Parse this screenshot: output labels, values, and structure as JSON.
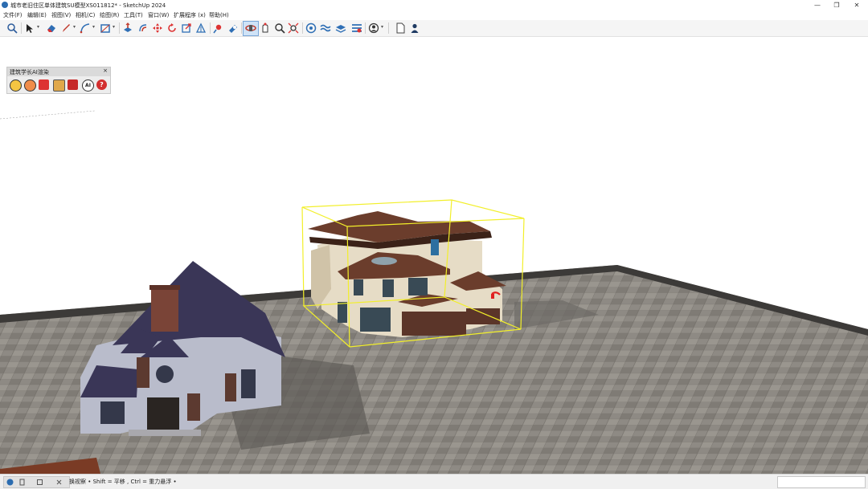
{
  "window": {
    "title": "城市老旧住区单体建筑SU模型XS011812* - SketchUp 2024",
    "minimize_glyph": "—",
    "restore_glyph": "❐",
    "close_glyph": "✕"
  },
  "menu": [
    {
      "label": "文件(F)"
    },
    {
      "label": "编辑(E)"
    },
    {
      "label": "视图(V)"
    },
    {
      "label": "相机(C)"
    },
    {
      "label": "绘图(R)"
    },
    {
      "label": "工具(T)"
    },
    {
      "label": "窗口(W)"
    },
    {
      "label": "扩展程序 (x)"
    },
    {
      "label": "帮助(H)"
    }
  ],
  "toolbar": {
    "tools": [
      "search-icon",
      "select-arrow-icon",
      "eraser-icon",
      "pencil-line-icon",
      "arc-icon",
      "rectangle-icon",
      "push-pull-icon",
      "offset-icon",
      "move-icon",
      "rotate-icon",
      "scale-icon",
      "tape-measure-icon",
      "paint-bucket-icon",
      "orbit-icon",
      "pan-icon",
      "zoom-icon",
      "zoom-extents-icon",
      "geo-location-icon",
      "sandbox-icon",
      "layers-icon",
      "extension-warehouse-icon",
      "account-icon",
      "new-file-icon",
      "profile-icon"
    ],
    "active_tool": "orbit-icon"
  },
  "ai_panel": {
    "title": "建筑学长AI渲染",
    "close_glyph": "×",
    "ai_badge": "AI",
    "help_glyph": "?"
  },
  "statusbar": {
    "hint": "换视察 • Shift = 平移 , Ctrl = 重力悬浮 •",
    "tray_icons": [
      "geo-icon",
      "info-icon",
      "square-icon",
      "close-icon"
    ]
  },
  "colors": {
    "ground": "#8b8680",
    "ground_edge": "#3c3a38",
    "selection": "#f2ef2a",
    "roof_left_house": "#3a3657",
    "roof_right_house": "#6b3d2c",
    "wall_right_house": "#e6dcc6",
    "wall_left_house": "#b9bccb"
  }
}
